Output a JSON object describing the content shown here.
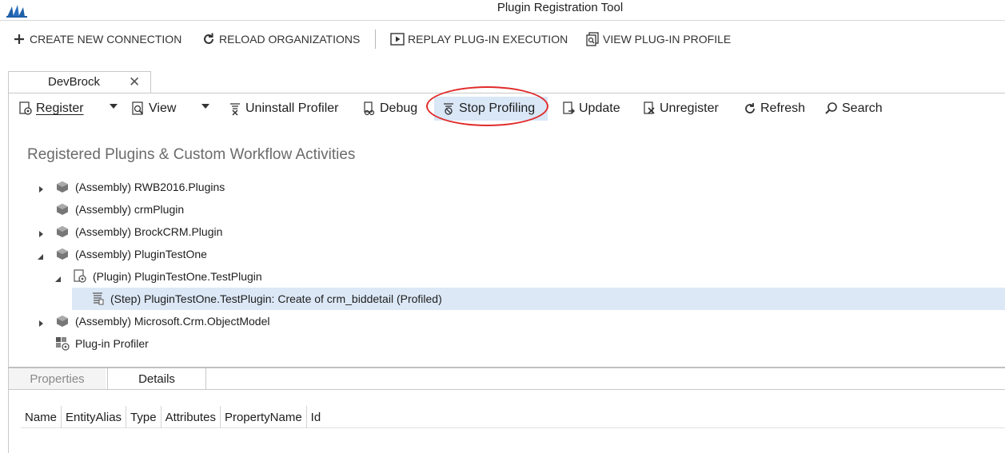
{
  "window": {
    "title": "Plugin Registration Tool",
    "logo_icon": "dynamics-logo-icon"
  },
  "commands": [
    {
      "label": "CREATE NEW CONNECTION",
      "icon": "plus-icon"
    },
    {
      "label": "RELOAD ORGANIZATIONS",
      "icon": "reload-icon"
    },
    {
      "label": "REPLAY PLUG-IN EXECUTION",
      "icon": "play-icon"
    },
    {
      "label": "VIEW PLUG-IN PROFILE",
      "icon": "profile-icon"
    }
  ],
  "connection_tab": {
    "label": "DevBrock",
    "close": "✕"
  },
  "toolbar": {
    "register": "Register",
    "view": "View",
    "uninstall_profiler": "Uninstall Profiler",
    "debug": "Debug",
    "stop_profiling": "Stop Profiling",
    "update": "Update",
    "unregister": "Unregister",
    "refresh": "Refresh",
    "search": "Search"
  },
  "section_title": "Registered Plugins & Custom Workflow Activities",
  "tree": [
    {
      "label": "(Assembly) RWB2016.Plugins",
      "state": "collapsed"
    },
    {
      "label": "(Assembly) crmPlugin",
      "state": "leaf"
    },
    {
      "label": "(Assembly) BrockCRM.Plugin",
      "state": "collapsed"
    },
    {
      "label": "(Assembly) PluginTestOne",
      "state": "expanded"
    },
    {
      "label": "(Plugin) PluginTestOne.TestPlugin",
      "state": "expanded"
    },
    {
      "label": "(Step) PluginTestOne.TestPlugin: Create of crm_biddetail (Profiled)",
      "state": "selected"
    },
    {
      "label": "(Assembly) Microsoft.Crm.ObjectModel",
      "state": "collapsed"
    },
    {
      "label": "Plug-in Profiler",
      "state": "leaf"
    }
  ],
  "bottom_tabs": [
    {
      "label": "Properties",
      "active": false
    },
    {
      "label": "Details",
      "active": true
    }
  ],
  "grid_columns": [
    "Name",
    "EntityAlias",
    "Type",
    "Attributes",
    "PropertyName",
    "Id"
  ],
  "colors": {
    "selection": "#dce8f6",
    "highlight_ring": "#e12b2b"
  }
}
